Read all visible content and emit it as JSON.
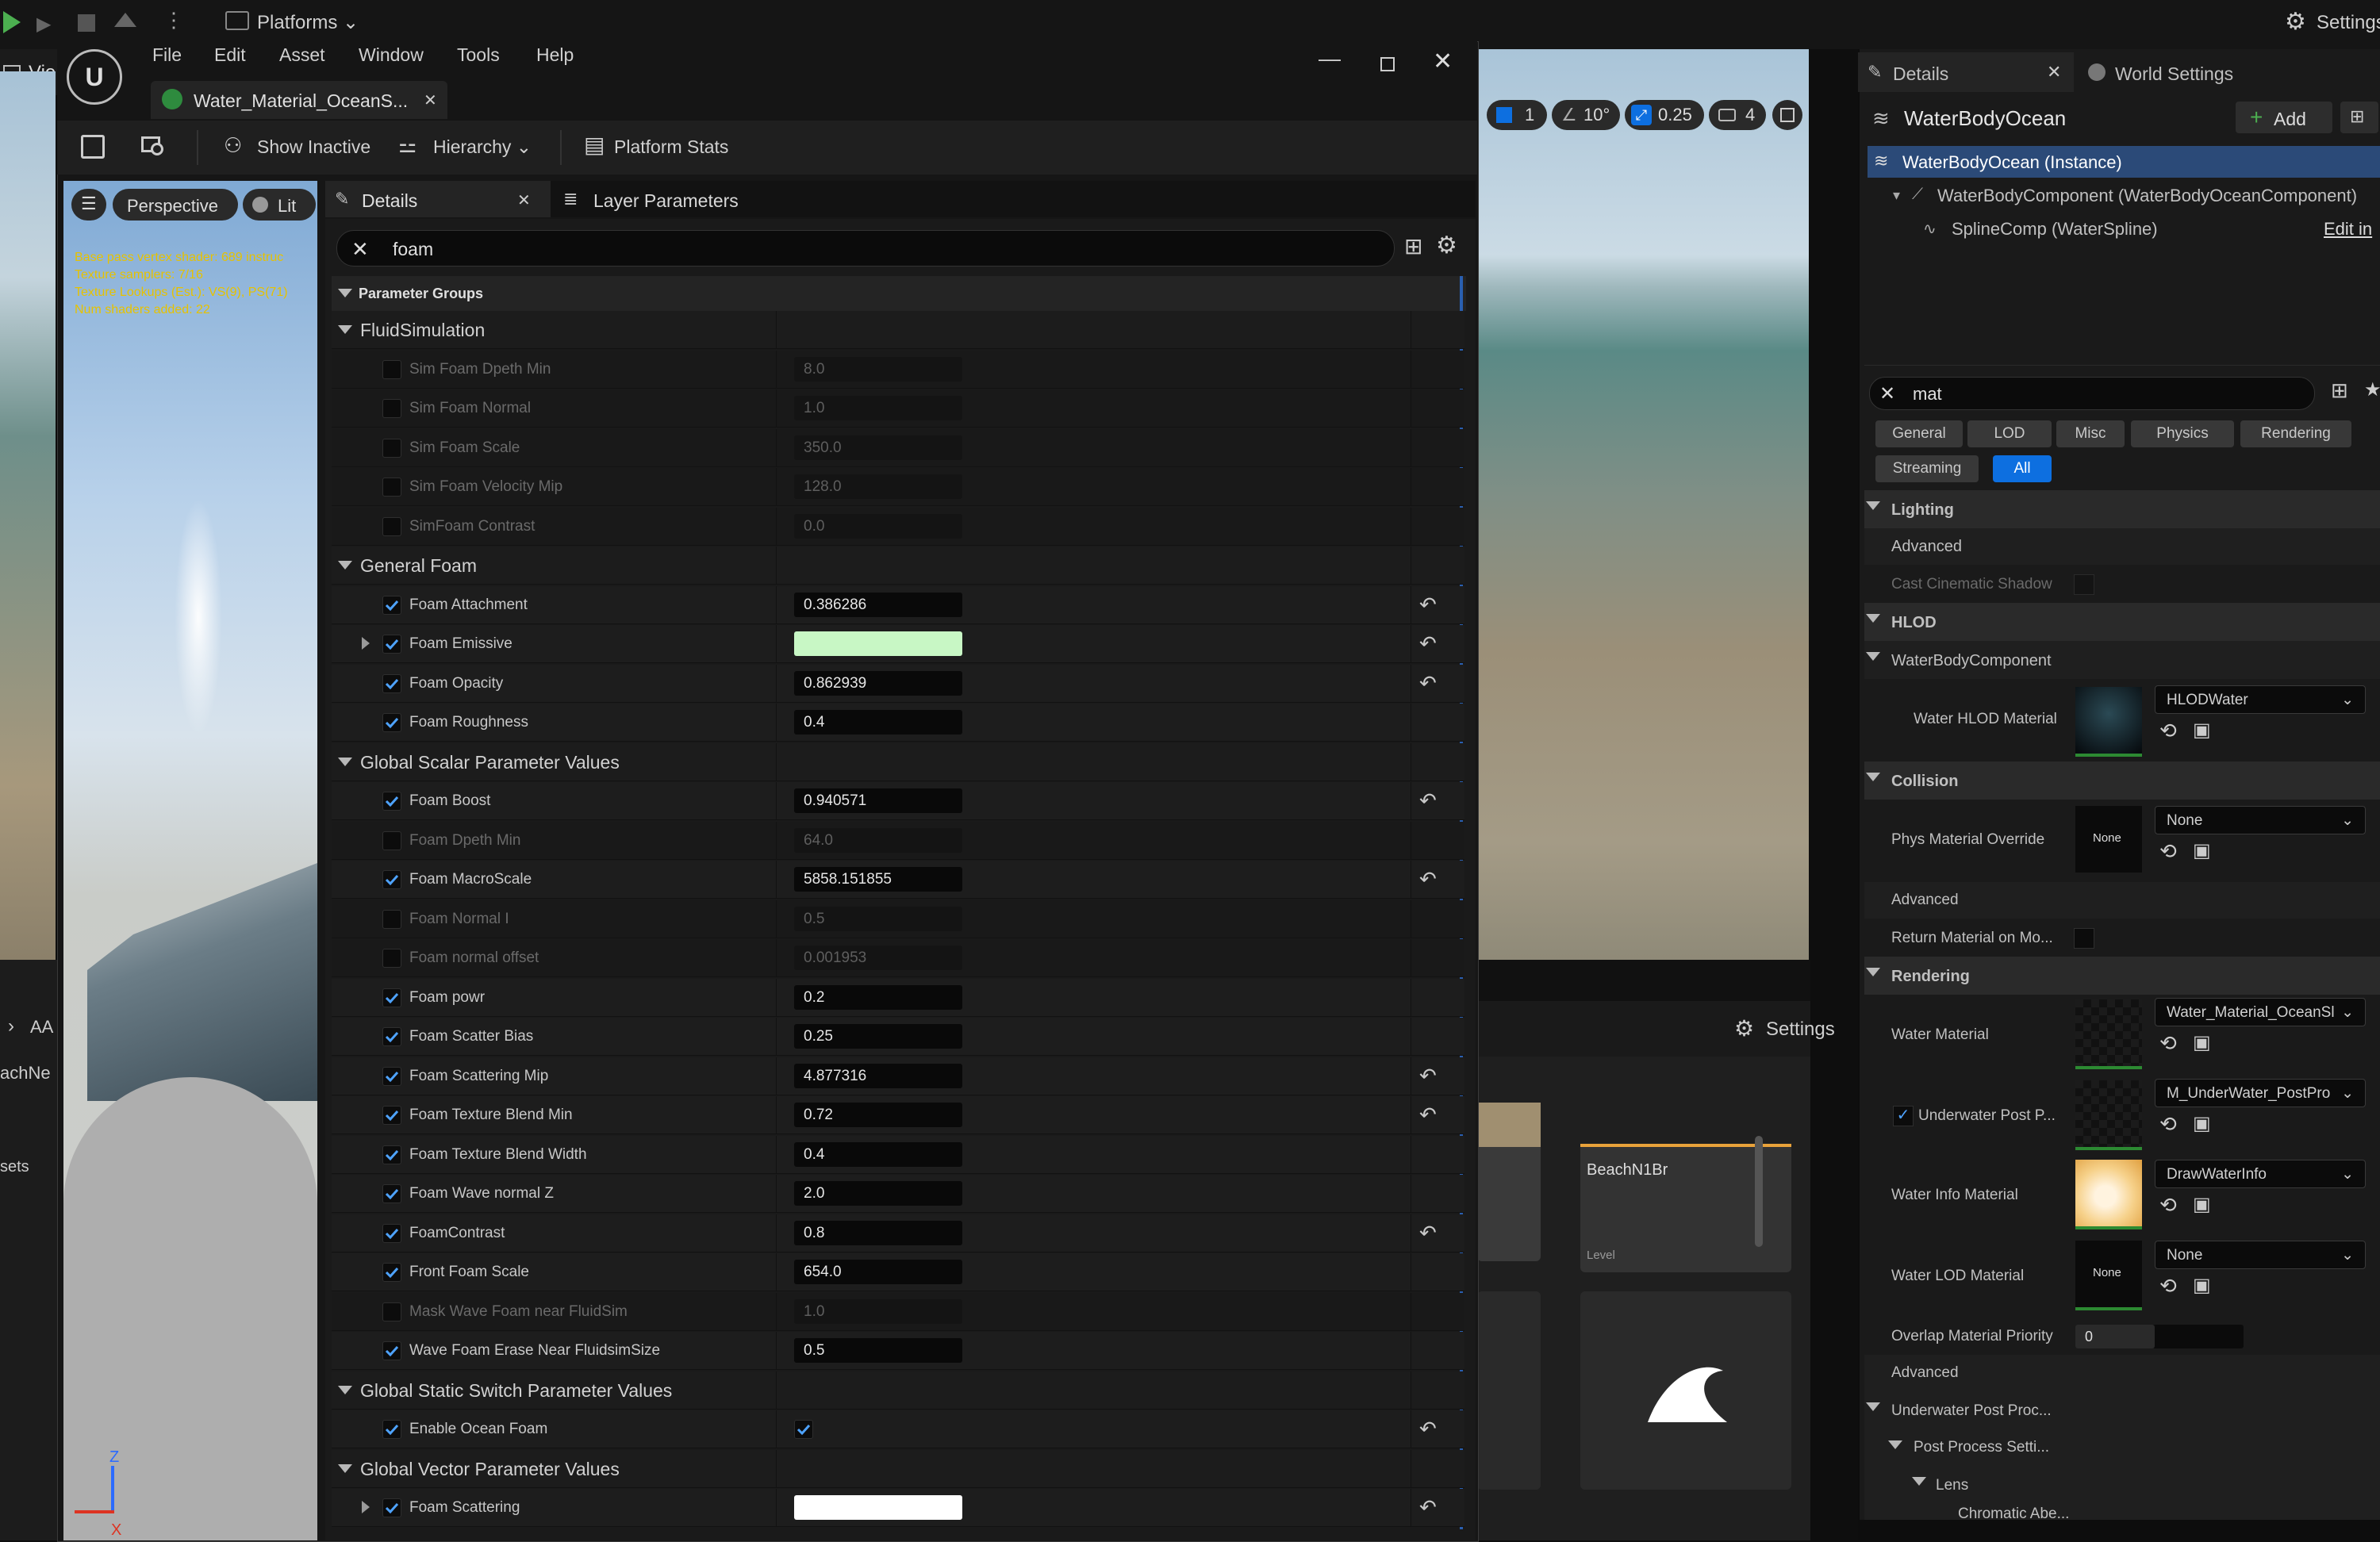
{
  "background": {
    "top_platforms": "Platforms",
    "top_settings": "Settings",
    "left_viewport_label": "Vie",
    "viewport_toolbar": {
      "grid_value": "1",
      "angle_value": "10°",
      "scale_value": "0.25",
      "camera_value": "4"
    },
    "left_side_labels": [
      "AA",
      "achNe",
      "sets"
    ],
    "content_settings": "Settings",
    "asset_card_name": "BeachN1Br",
    "asset_card_type": "Level"
  },
  "material_window": {
    "menu": [
      "File",
      "Edit",
      "Asset",
      "Window",
      "Tools",
      "Help"
    ],
    "doc_tab": "Water_Material_OceanS...",
    "toolbar": {
      "show_inactive": "Show Inactive",
      "hierarchy": "Hierarchy",
      "platform_stats": "Platform Stats"
    },
    "preview": {
      "perspective": "Perspective",
      "lit": "Lit",
      "stats": [
        "Base pass vertex shader: 689 instruc",
        "Texture samplers: 7/16",
        "Texture Lookups (Est.): VS(9), PS(71)",
        "Num shaders added: 22"
      ],
      "axis_z": "Z",
      "axis_x": "X"
    },
    "tabs": {
      "details": "Details",
      "layer_parameters": "Layer Parameters"
    },
    "search_value": "foam",
    "header": "Parameter Groups",
    "groups": [
      {
        "name": "FluidSimulation",
        "params": [
          {
            "name": "Sim Foam Dpeth Min",
            "value": "8.0",
            "enabled": false
          },
          {
            "name": "Sim Foam Normal",
            "value": "1.0",
            "enabled": false
          },
          {
            "name": "Sim Foam Scale",
            "value": "350.0",
            "enabled": false
          },
          {
            "name": "Sim Foam Velocity Mip",
            "value": "128.0",
            "enabled": false
          },
          {
            "name": "SimFoam Contrast",
            "value": "0.0",
            "enabled": false
          }
        ]
      },
      {
        "name": "General Foam",
        "params": [
          {
            "name": "Foam Attachment",
            "value": "0.386286",
            "enabled": true,
            "reset": true
          },
          {
            "name": "Foam Emissive",
            "value": "",
            "color": "#c8f7c5",
            "enabled": true,
            "reset": true,
            "expandable": true
          },
          {
            "name": "Foam Opacity",
            "value": "0.862939",
            "enabled": true,
            "reset": true
          },
          {
            "name": "Foam Roughness",
            "value": "0.4",
            "enabled": true
          }
        ]
      },
      {
        "name": "Global Scalar Parameter Values",
        "params": [
          {
            "name": "Foam Boost",
            "value": "0.940571",
            "enabled": true,
            "reset": true
          },
          {
            "name": "Foam Dpeth Min",
            "value": "64.0",
            "enabled": false
          },
          {
            "name": "Foam MacroScale",
            "value": "5858.151855",
            "enabled": true,
            "reset": true
          },
          {
            "name": "Foam Normal I",
            "value": "0.5",
            "enabled": false
          },
          {
            "name": "Foam normal offset",
            "value": "0.001953",
            "enabled": false
          },
          {
            "name": "Foam powr",
            "value": "0.2",
            "enabled": true
          },
          {
            "name": "Foam Scatter Bias",
            "value": "0.25",
            "enabled": true
          },
          {
            "name": "Foam Scattering Mip",
            "value": "4.877316",
            "enabled": true,
            "reset": true
          },
          {
            "name": "Foam Texture Blend Min",
            "value": "0.72",
            "enabled": true,
            "reset": true
          },
          {
            "name": "Foam Texture Blend Width",
            "value": "0.4",
            "enabled": true
          },
          {
            "name": "Foam Wave normal Z",
            "value": "2.0",
            "enabled": true
          },
          {
            "name": "FoamContrast",
            "value": "0.8",
            "enabled": true,
            "reset": true
          },
          {
            "name": "Front Foam Scale",
            "value": "654.0",
            "enabled": true
          },
          {
            "name": "Mask Wave Foam near FluidSim",
            "value": "1.0",
            "enabled": false
          },
          {
            "name": "Wave Foam Erase Near FluidsimSize",
            "value": "0.5",
            "enabled": true
          }
        ]
      },
      {
        "name": "Global Static Switch Parameter Values",
        "params": [
          {
            "name": "Enable Ocean Foam",
            "value": "",
            "checkbox_value": true,
            "enabled": true,
            "reset": true
          }
        ]
      },
      {
        "name": "Global Vector Parameter Values",
        "params": [
          {
            "name": "Foam Scattering",
            "value": "",
            "color": "#ffffff",
            "enabled": true,
            "reset": true,
            "expandable": true
          }
        ]
      }
    ]
  },
  "right_panel": {
    "tab_details": "Details",
    "tab_world_settings": "World Settings",
    "actor_name": "WaterBodyOcean",
    "add_label": "Add",
    "tree": [
      "WaterBodyOcean (Instance)",
      "WaterBodyComponent (WaterBodyOceanComponent)",
      "SplineComp (WaterSpline)"
    ],
    "edit_in": "Edit in",
    "search_value": "mat",
    "filters_row1": [
      "General",
      "LOD",
      "Misc",
      "Physics",
      "Rendering"
    ],
    "filters_row2": [
      "Streaming",
      "All"
    ],
    "lighting": "Lighting",
    "advanced1": "Advanced",
    "cast_cinematic_shadow": "Cast Cinematic Shadow",
    "hlod": "HLOD",
    "waterbody_component": "WaterBodyComponent",
    "water_hlod_material": "Water HLOD Material",
    "hlod_value": "HLODWater",
    "collision": "Collision",
    "phys_material_override": "Phys Material Override",
    "none": "None",
    "advanced2": "Advanced",
    "return_material": "Return Material on Mo...",
    "rendering": "Rendering",
    "water_material": "Water Material",
    "water_material_value": "Water_Material_OceanSl",
    "underwater_post": "Underwater Post P...",
    "underwater_value": "M_UnderWater_PostPro",
    "water_info_material": "Water Info Material",
    "water_info_value": "DrawWaterInfo",
    "water_lod_material": "Water LOD Material",
    "overlap_priority": "Overlap Material Priority",
    "overlap_value": "0",
    "advanced3": "Advanced",
    "underwater_post_proc": "Underwater Post Proc...",
    "post_process_settings": "Post Process Setti...",
    "lens": "Lens",
    "chromatic": "Chromatic Abe..."
  },
  "colors": {
    "accent": "#0d6fe0",
    "check": "#4ea3ff"
  }
}
